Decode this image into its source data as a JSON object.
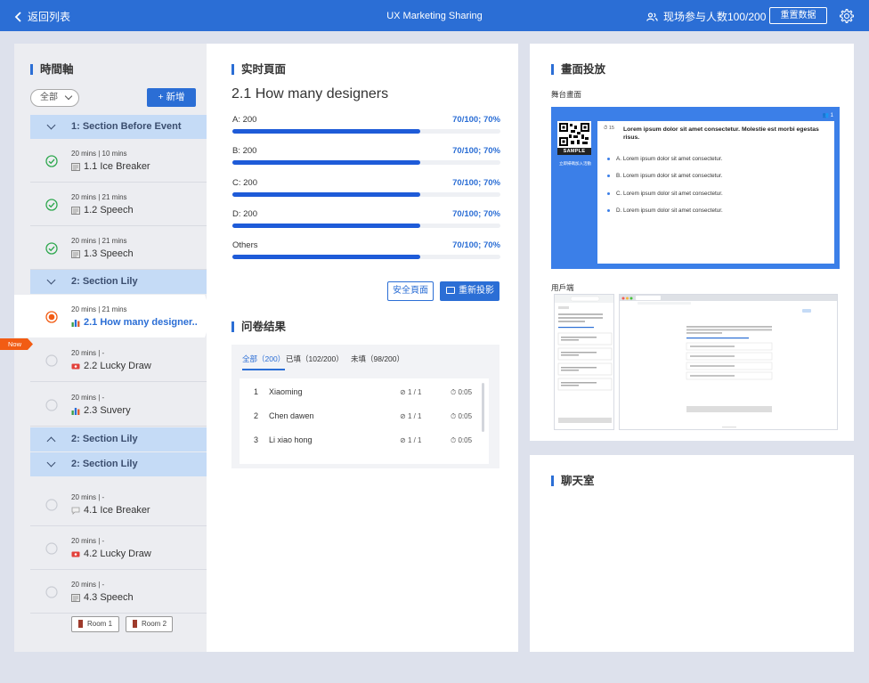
{
  "topbar": {
    "back_label": "返回列表",
    "title": "UX Marketing Sharing",
    "attendance": "现场参与人数100/200",
    "reset_label": "重置数据"
  },
  "timeline": {
    "title": "時間軸",
    "filter_value": "全部",
    "add_label": "+ 新增",
    "now_label": "Now",
    "sections": [
      {
        "label": "1: Section Before Event",
        "state": "expanded"
      },
      {
        "label": "2: Section Lily",
        "state": "expanded"
      },
      {
        "label": "2: Section Lily",
        "state": "collapsed"
      },
      {
        "label": "2: Section Lily",
        "state": "expanded"
      }
    ],
    "items": [
      {
        "meta": "20 mins  |  10 mins",
        "name": "1.1  Ice Breaker",
        "icon": "document-icon",
        "status": "done"
      },
      {
        "meta": "20 mins  |  21 mins",
        "name": "1.2  Speech",
        "icon": "document-icon",
        "status": "done"
      },
      {
        "meta": "20 mins  |  21 mins",
        "name": "1.3  Speech",
        "icon": "document-icon",
        "status": "done"
      },
      {
        "meta": "20 mins  |  21 mins",
        "name": "2.1 How many designer..",
        "icon": "bar-chart-icon",
        "status": "current"
      },
      {
        "meta": "20 mins  |  -",
        "name": "2.2 Lucky Draw",
        "icon": "ticket-icon",
        "status": "pending"
      },
      {
        "meta": "20 mins  |  -",
        "name": "2.3 Suvery",
        "icon": "bar-chart-icon",
        "status": "pending"
      },
      {
        "meta": "20 mins  |  -",
        "name": "4.1  Ice Breaker",
        "icon": "chat-bubble-icon",
        "status": "pending"
      },
      {
        "meta": "20 mins  |  -",
        "name": "4.2 Lucky Draw",
        "icon": "ticket-icon",
        "status": "pending"
      },
      {
        "meta": "20 mins  |  -",
        "name": "4.3  Speech",
        "icon": "document-icon",
        "status": "pending"
      }
    ],
    "rooms": [
      "Room 1",
      "Room 2"
    ]
  },
  "live": {
    "title": "实时頁面",
    "question": "2.1 How many designers",
    "options": [
      {
        "label": "A: 200",
        "value": "70/100; 70%",
        "fraction": 0.7
      },
      {
        "label": "B: 200",
        "value": "70/100; 70%",
        "fraction": 0.7
      },
      {
        "label": "C: 200",
        "value": "70/100; 70%",
        "fraction": 0.7
      },
      {
        "label": "D: 200",
        "value": "70/100; 70%",
        "fraction": 0.7
      },
      {
        "label": "Others",
        "value": "70/100; 70%",
        "fraction": 0.7
      }
    ],
    "safe_label": "安全頁面",
    "reproject_label": "重新投影"
  },
  "survey": {
    "title": "问卷结果",
    "tabs": [
      "全部（200）",
      "已填（102/200）",
      "未填（98/200）"
    ],
    "rows": [
      {
        "no": "1",
        "name": "Xiaoming",
        "score": "1 / 1",
        "time": "0:05"
      },
      {
        "no": "2",
        "name": "Chen dawen",
        "score": "1 / 1",
        "time": "0:05"
      },
      {
        "no": "3",
        "name": "Li xiao hong",
        "score": "1 / 1",
        "time": "0:05"
      }
    ]
  },
  "projection": {
    "title": "畫面投放",
    "stage_label": "舞台畫面",
    "client_label": "用戶端",
    "stage": {
      "sample": "SAMPLE",
      "scan_text": "立即掃碼加入活動",
      "user_count": "1",
      "question_no": "15",
      "question": "Lorem ipsum dolor sit amet consectetur. Molestie est morbi egestas risus.",
      "options": [
        "A. Lorem ipsum dolor sit amet consectetur.",
        "B. Lorem ipsum dolor sit amet consectetur.",
        "C. Lorem ipsum dolor sit amet consectetur.",
        "D. Lorem ipsum dolor sit amet consectetur."
      ]
    }
  },
  "chat": {
    "title": "聊天室"
  },
  "colors": {
    "primary": "#2b6ed5",
    "section_bg": "#c5dbf6",
    "now": "#f25c14",
    "done": "#2fa84f",
    "current": "#f25c14"
  }
}
